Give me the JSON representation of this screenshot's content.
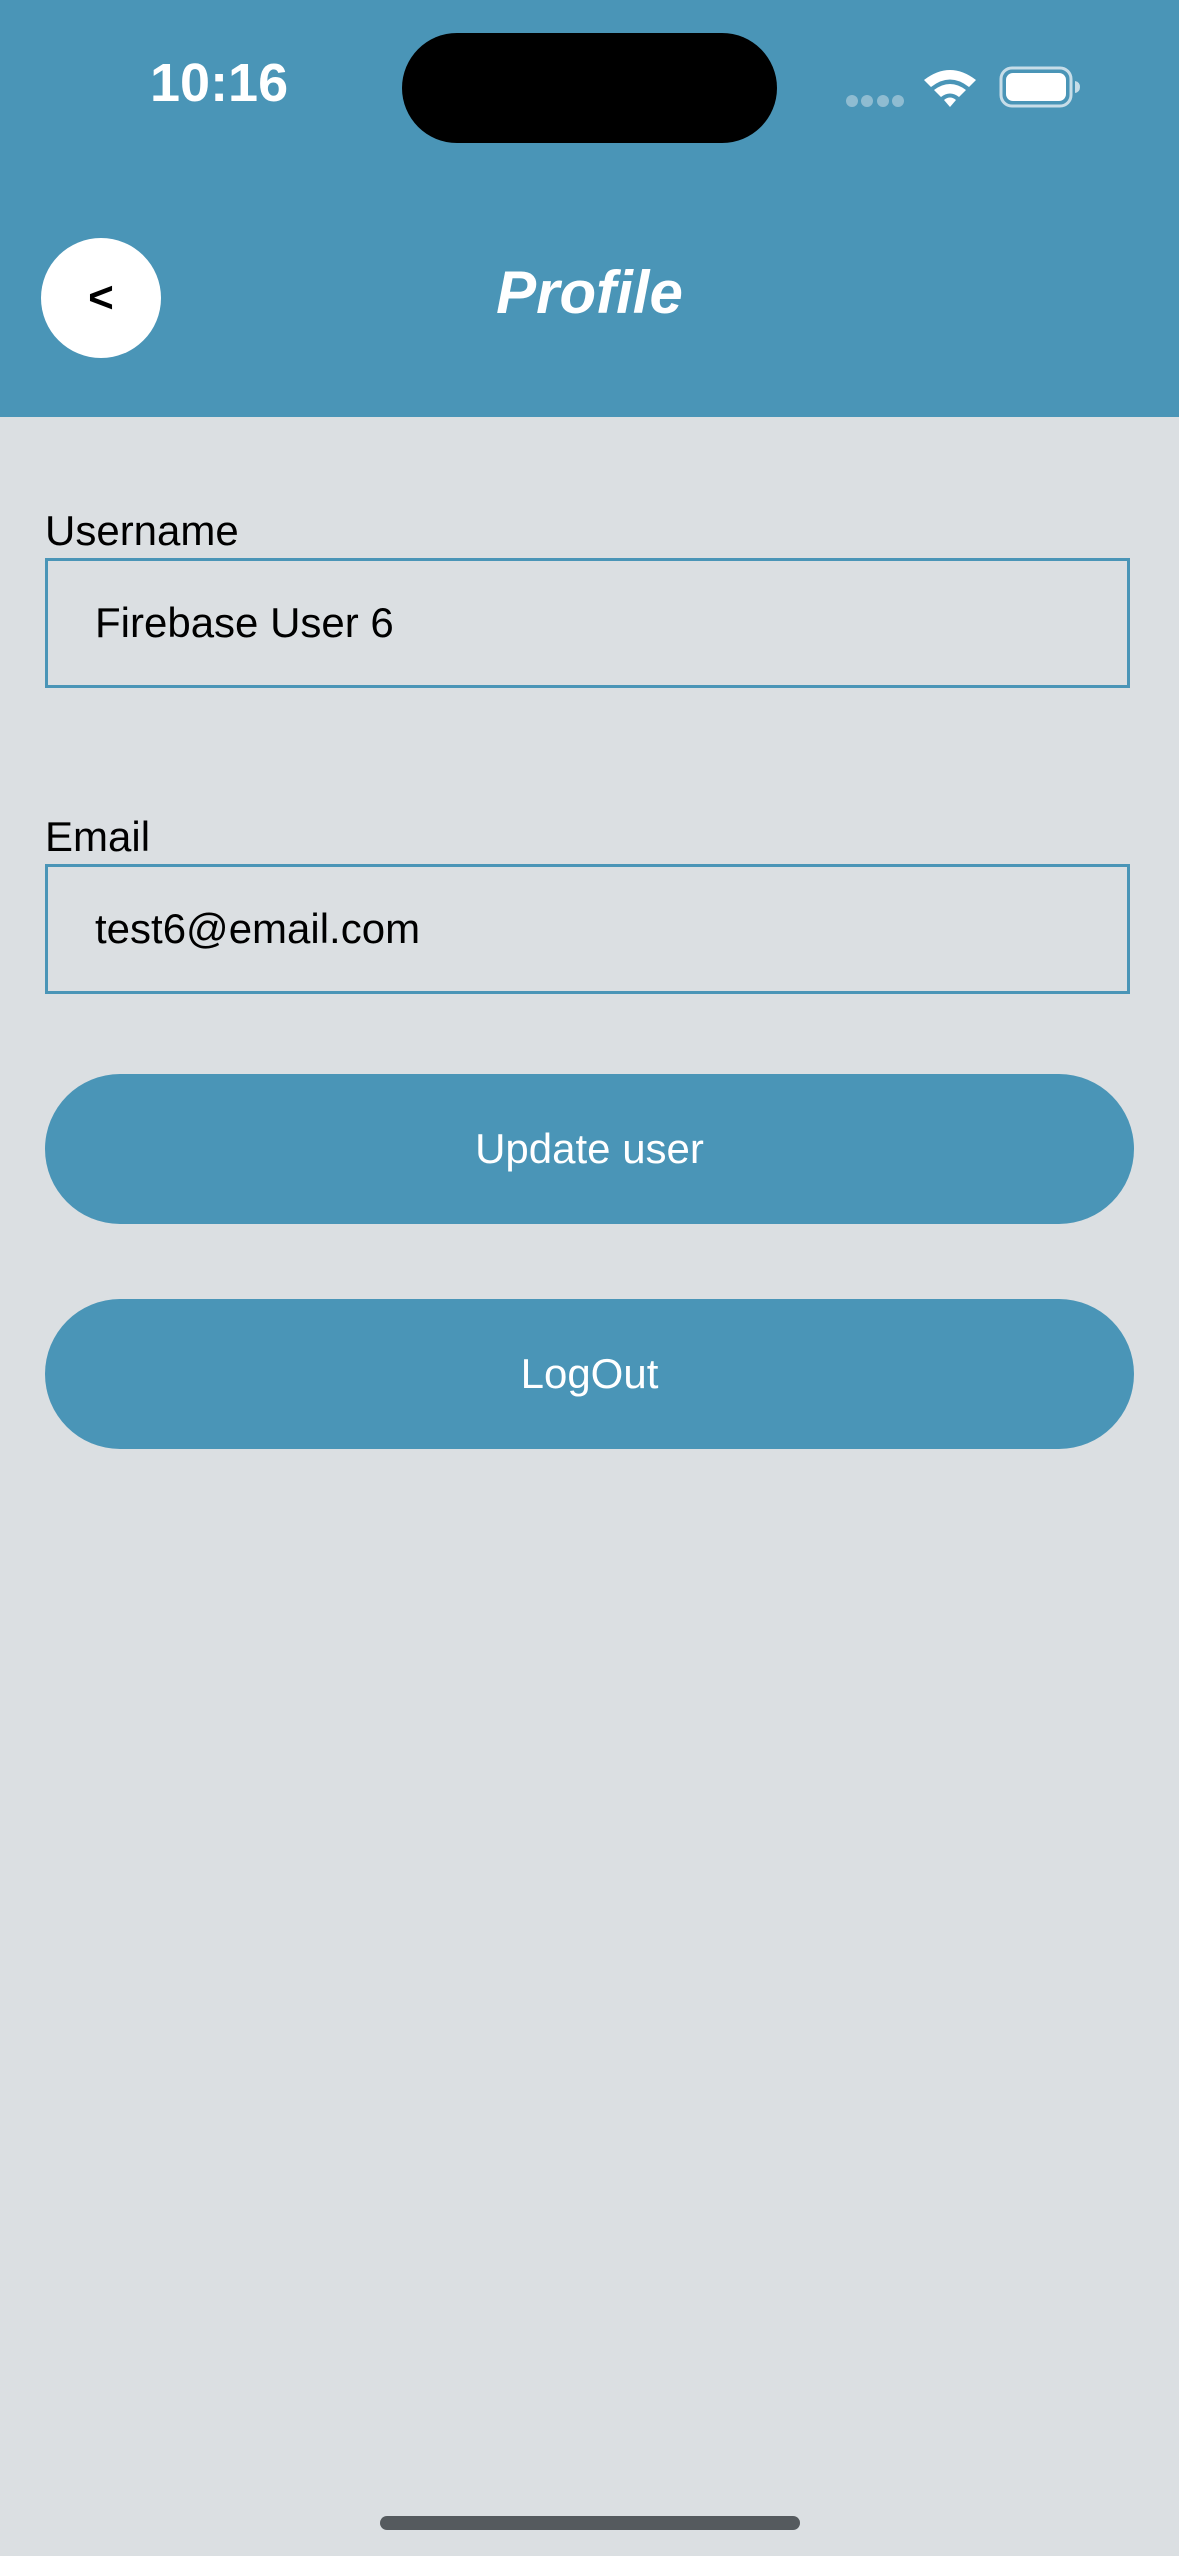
{
  "status_bar": {
    "time": "10:16"
  },
  "header": {
    "title": "Profile",
    "back_label": "<"
  },
  "form": {
    "username_label": "Username",
    "username_value": "Firebase User 6",
    "email_label": "Email",
    "email_value": "test6@email.com"
  },
  "actions": {
    "update_label": "Update user",
    "logout_label": "LogOut"
  },
  "colors": {
    "accent": "#4A95B7",
    "background": "#DBDFE2"
  },
  "icons": [
    "wifi-icon",
    "battery-icon",
    "signal-icon"
  ]
}
